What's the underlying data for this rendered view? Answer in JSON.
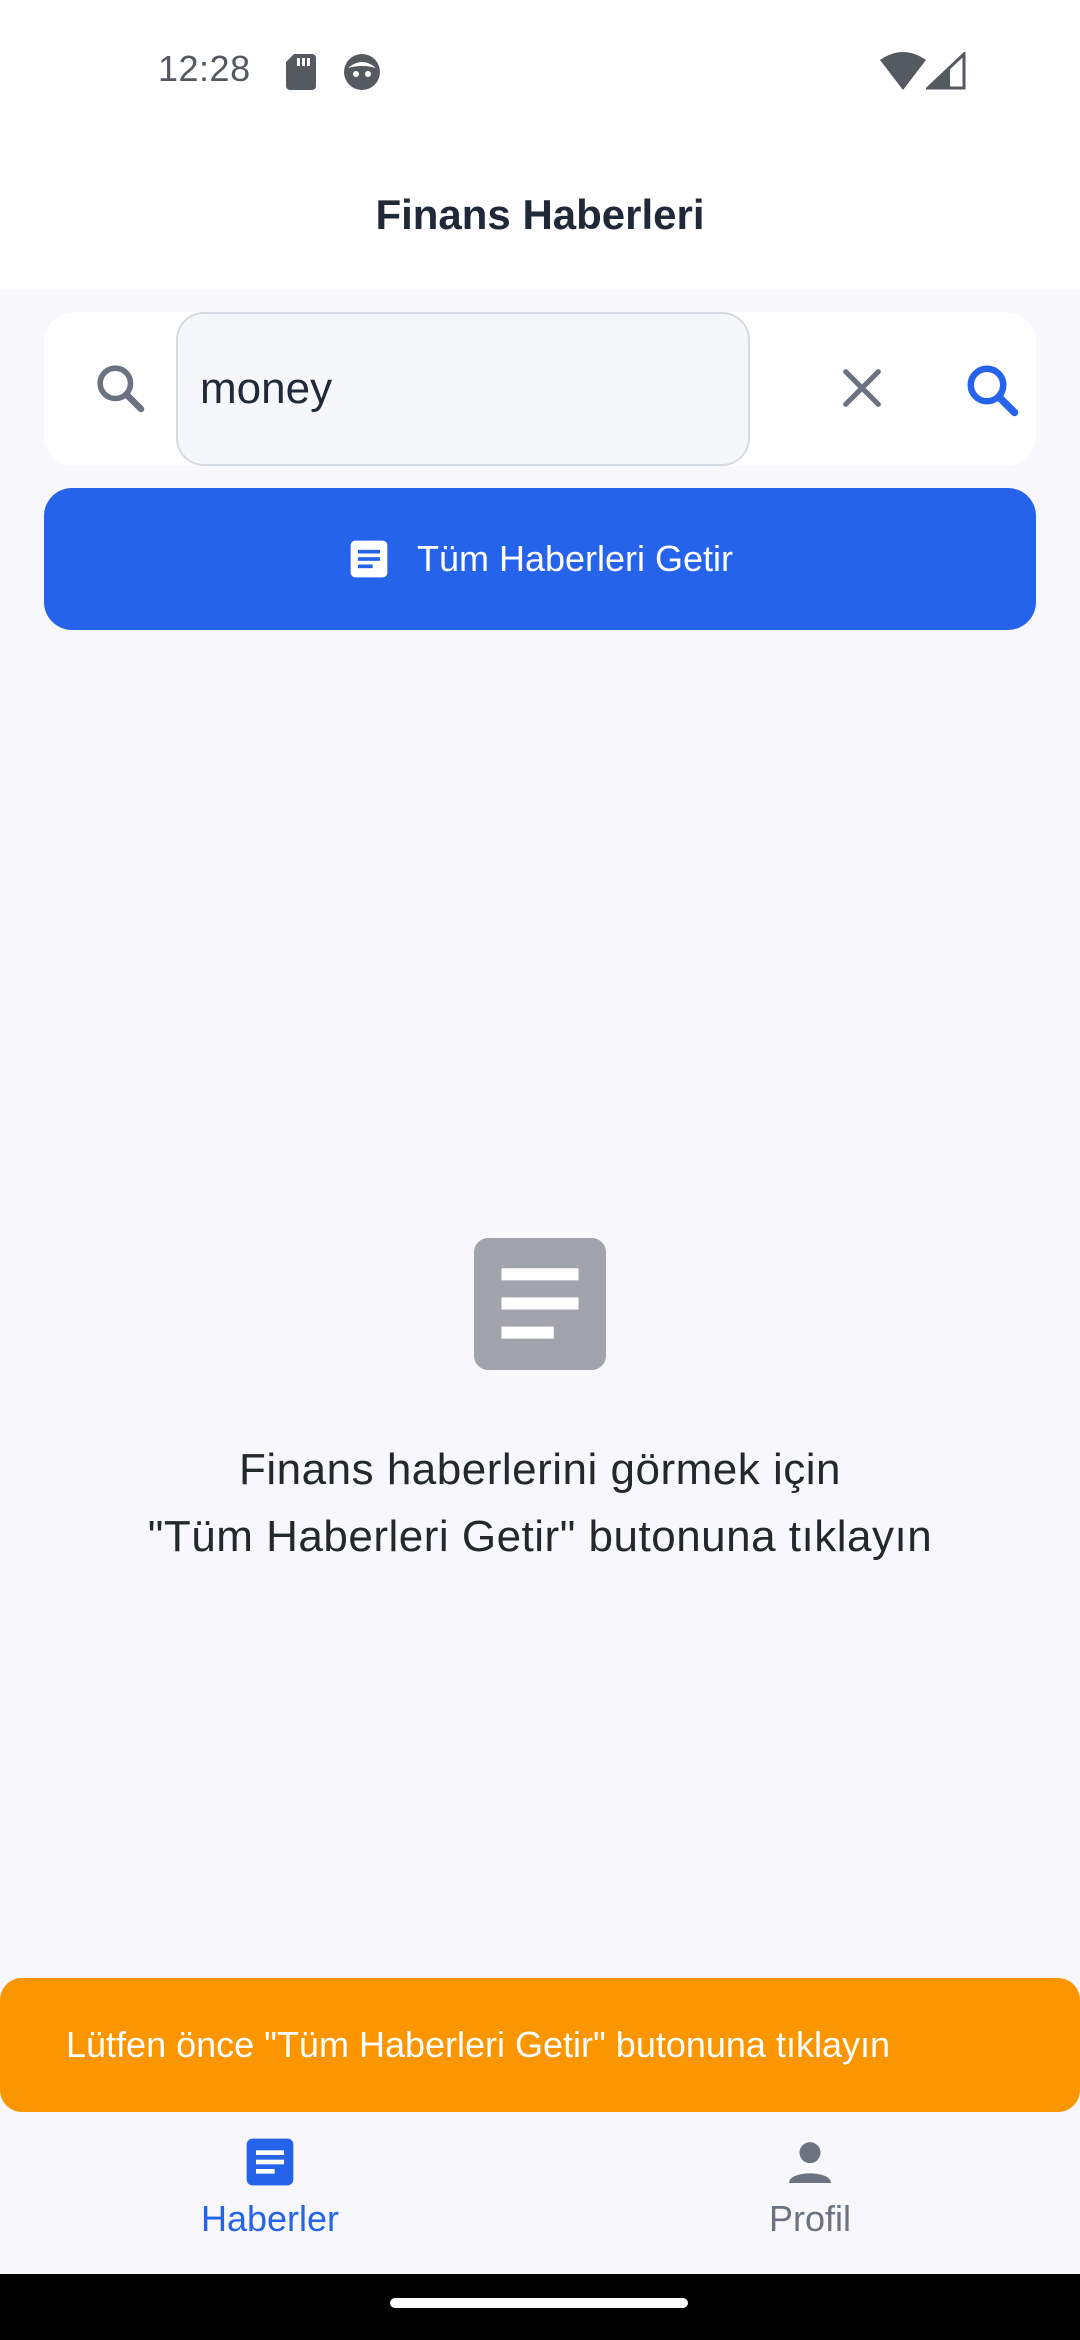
{
  "status_bar": {
    "time": "12:28",
    "icons": [
      "sd-card-icon",
      "face-icon",
      "wifi-icon",
      "signal-icon"
    ]
  },
  "app_bar": {
    "title": "Finans Haberleri"
  },
  "search": {
    "value": "money",
    "lead_icon": "search-icon",
    "clear_icon": "close-icon",
    "submit_icon": "search-icon"
  },
  "fetch_button": {
    "label": "Tüm Haberleri Getir",
    "icon": "article-icon"
  },
  "empty_state": {
    "icon": "article-icon",
    "line1": "Finans haberlerini görmek için",
    "line2": "\"Tüm Haberleri Getir\" butonuna tıklayın"
  },
  "snackbar": {
    "message": "Lütfen önce \"Tüm Haberleri Getir\" butonuna tıklayın"
  },
  "bottom_nav": {
    "items": [
      {
        "label": "Haberler",
        "icon": "article-icon",
        "active": true
      },
      {
        "label": "Profil",
        "icon": "person-icon",
        "active": false
      }
    ]
  },
  "colors": {
    "primary": "#2563eb",
    "background": "#f7f7fc",
    "snackbar": "#fb9600",
    "muted_icon": "#a1a4ad",
    "title_text": "#1f2937",
    "inactive_nav": "#6b7280"
  }
}
